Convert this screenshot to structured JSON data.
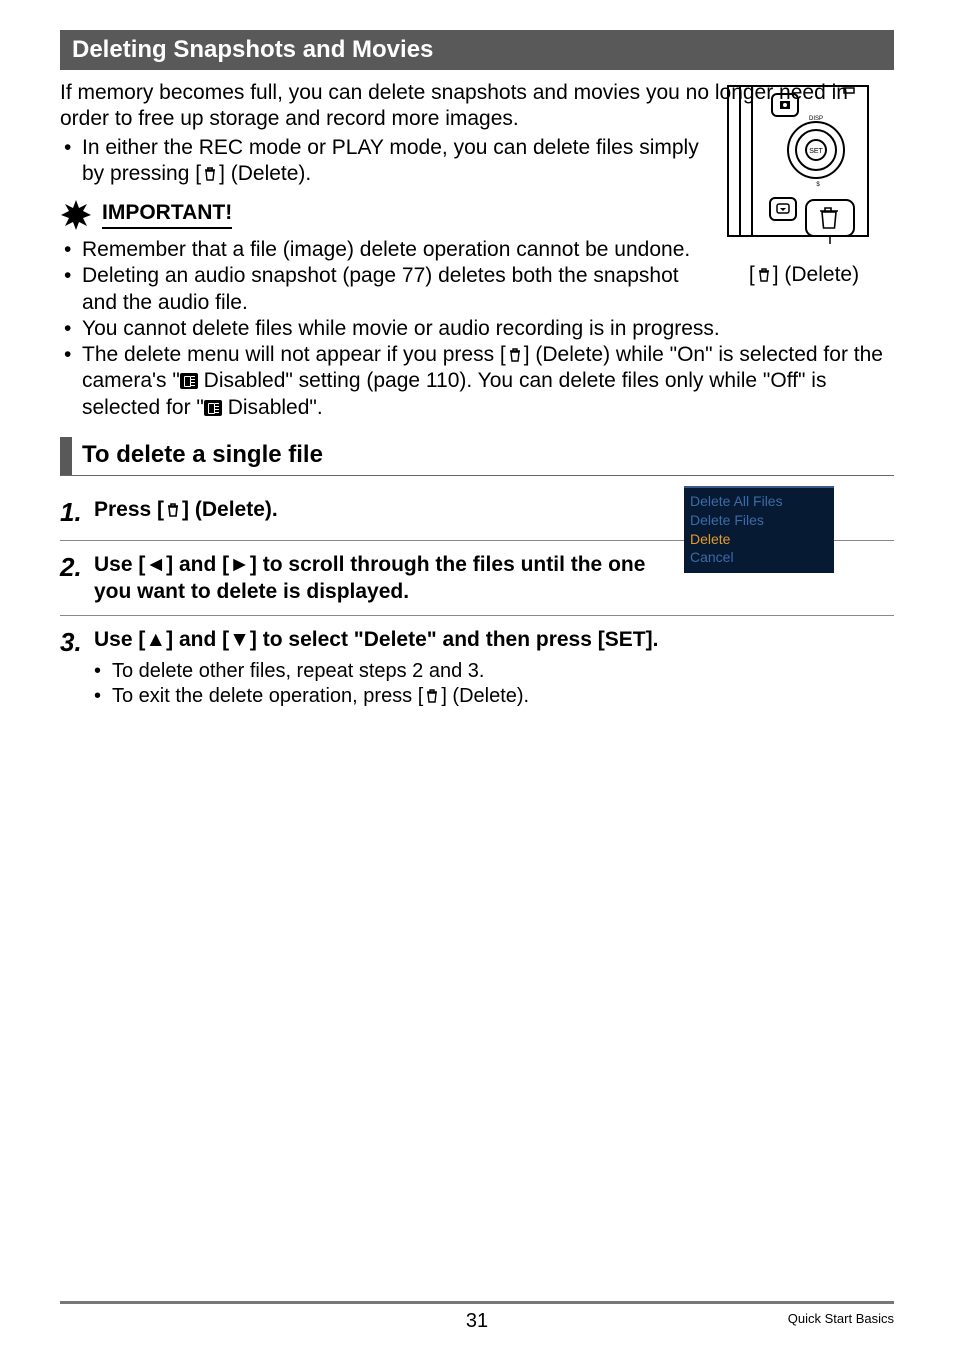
{
  "heading": "Deleting Snapshots and Movies",
  "intro": "If memory becomes full, you can delete snapshots and movies you no longer need in order to free up storage and record more images.",
  "intro_bullet_pre": "In either the REC mode or PLAY mode, you can delete files simply by pressing [",
  "intro_bullet_post": "] (Delete).",
  "important_label": "IMPORTANT!",
  "important_bullets": {
    "b1": "Remember that a file (image) delete operation cannot be undone.",
    "b2": "Deleting an audio snapshot (page 77) deletes both the snapshot and the audio file.",
    "b3": "You cannot delete files while movie or audio recording is in progress.",
    "b4_pre": "The delete menu will not appear if you press [",
    "b4_mid": "] (Delete) while \"On\" is selected for the camera's \"",
    "b4_mid2": " Disabled\" setting (page 110). You can delete files only while \"Off\" is selected for \"",
    "b4_post": " Disabled\"."
  },
  "fig_label_pre": "[",
  "fig_label_post": "] (Delete)",
  "sub_heading": "To delete a single file",
  "steps": {
    "s1_num": "1.",
    "s1_pre": "Press [",
    "s1_post": "] (Delete).",
    "s2_num": "2.",
    "s2": "Use [◄] and [►] to scroll through the files until the one you want to delete is displayed.",
    "s3_num": "3.",
    "s3": "Use [▲] and [▼] to select \"Delete\" and then press [SET].",
    "s3_sub1": "To delete other files, repeat steps 2 and 3.",
    "s3_sub2_pre": "To exit the delete operation, press [",
    "s3_sub2_post": "] (Delete)."
  },
  "menu": {
    "i1": "Delete All Files",
    "i2": "Delete Files",
    "i3": "Delete",
    "i4": "Cancel"
  },
  "footer": {
    "page": "31",
    "section": "Quick Start Basics"
  }
}
